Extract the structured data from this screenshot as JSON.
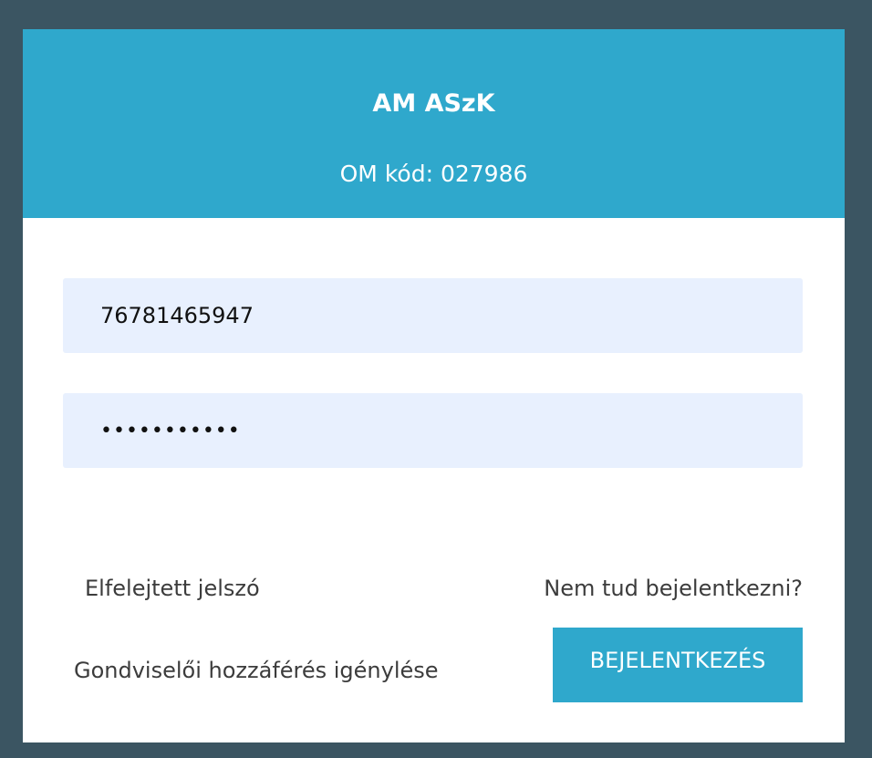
{
  "header": {
    "school_name": "AM ASzK",
    "om_code": "OM kód: 027986"
  },
  "form": {
    "username_value": "76781465947",
    "password_masked": "•••••••••••"
  },
  "links": {
    "forgot_password": "Elfelejtett jelszó",
    "cannot_login": "Nem tud bejelentkezni?",
    "guardian_access": "Gondviselői hozzáférés igénylése"
  },
  "actions": {
    "login_label": "BEJELENTKEZÉS"
  },
  "colors": {
    "accent": "#2fa8cc",
    "background": "#3b5562",
    "field_background": "#e8f0fe"
  }
}
